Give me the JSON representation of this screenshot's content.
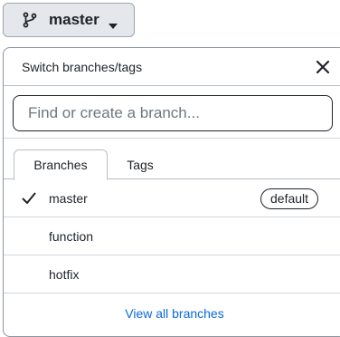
{
  "branch_button": {
    "icon": "git-branch-icon",
    "current_branch": "master",
    "caret_icon": "chevron-down-icon"
  },
  "panel": {
    "title": "Switch branches/tags",
    "close_icon": "close-icon",
    "filter": {
      "placeholder": "Find or create a branch...",
      "value": ""
    },
    "tabs": [
      {
        "label": "Branches",
        "active": true
      },
      {
        "label": "Tags",
        "active": false
      }
    ],
    "branches": [
      {
        "name": "master",
        "selected": true,
        "badge": "default"
      },
      {
        "name": "function",
        "selected": false,
        "badge": ""
      },
      {
        "name": "hotfix",
        "selected": false,
        "badge": ""
      }
    ],
    "footer_link": "View all branches"
  },
  "colors": {
    "button_bg": "#e4e7eb",
    "link": "#0969da",
    "border": "#8c959f"
  }
}
